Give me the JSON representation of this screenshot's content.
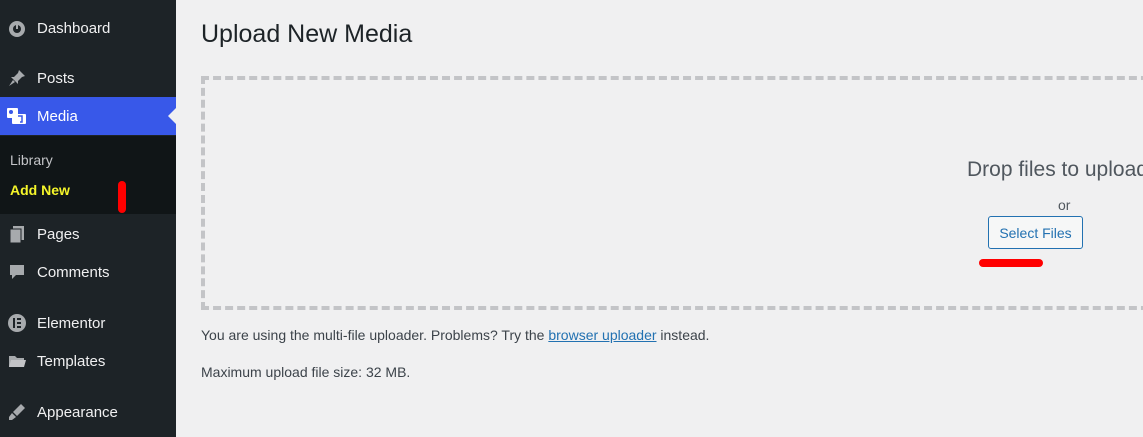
{
  "sidebar": {
    "items": [
      {
        "label": "Dashboard",
        "icon": "dashboard-icon"
      },
      {
        "label": "Posts",
        "icon": "pin-icon"
      },
      {
        "label": "Media",
        "icon": "media-icon",
        "active": true
      },
      {
        "label": "Pages",
        "icon": "pages-icon"
      },
      {
        "label": "Comments",
        "icon": "comment-icon"
      },
      {
        "label": "Elementor",
        "icon": "elementor-icon"
      },
      {
        "label": "Templates",
        "icon": "folder-icon"
      },
      {
        "label": "Appearance",
        "icon": "brush-icon"
      }
    ],
    "submenu": {
      "library": "Library",
      "add_new": "Add New"
    }
  },
  "main": {
    "title": "Upload New Media",
    "drop_text": "Drop files to upload",
    "or_text": "or",
    "select_button": "Select Files",
    "note_prefix": "You are using the multi-file uploader. Problems? Try the ",
    "note_link": "browser uploader",
    "note_suffix": " instead.",
    "max_size": "Maximum upload file size: 32 MB."
  },
  "colors": {
    "sidebar_bg": "#1d2327",
    "active_bg": "#3858e9",
    "submenu_highlight": "#f5f52a",
    "link": "#2271b1",
    "annotation": "#ff0000"
  }
}
